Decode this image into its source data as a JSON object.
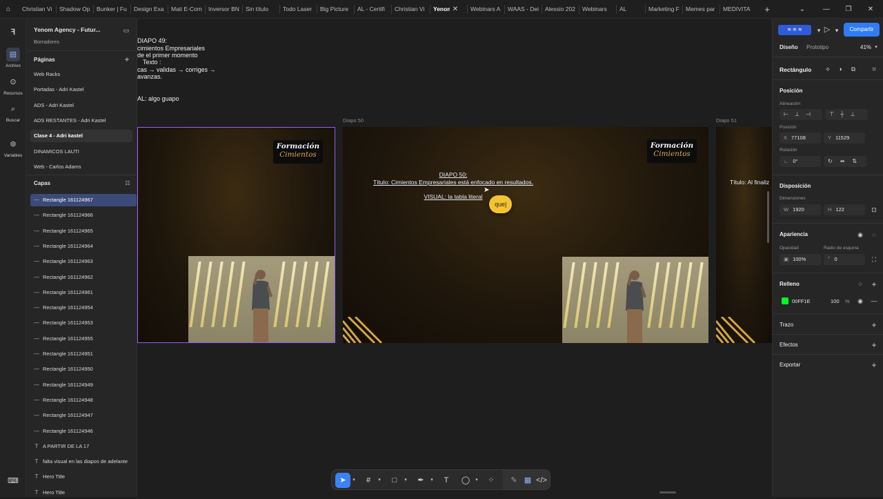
{
  "browser": {
    "tabs": [
      "Christian Vi",
      "Shadow Op",
      "Bunker | Fu",
      "Design Exa",
      "Mati E-Com",
      "Inversor BN",
      "Sin título",
      "Todo Laser",
      "Big Picture",
      "AL - Certifi",
      "Christian Vi",
      "Yenom",
      "Webinars A",
      "WAAS - Dei",
      "Alessio 202",
      "Webinars",
      "AL",
      "Marketing F",
      "Memes par",
      "MEDIVITA"
    ],
    "active_tab_index": 11
  },
  "rail": {
    "items": [
      {
        "label": "Archivo",
        "icon": "file-icon"
      },
      {
        "label": "Recursos",
        "icon": "assets-icon"
      },
      {
        "label": "Buscar",
        "icon": "search-icon"
      },
      {
        "label": "Variables",
        "icon": "variables-icon"
      }
    ]
  },
  "file": {
    "name": "Yenom Agency - Futur...",
    "subtitle": "Borradores"
  },
  "pages": {
    "title": "Páginas",
    "items": [
      "Web Racks",
      "Portadas - Adri Kastel",
      "ADS - Adri Kastel",
      "ADS RESTANTES - Adri Kastel",
      "Clase 4 - Adri kastel",
      "DINAMICOS LAUTI",
      "Web - Carlos Adams"
    ],
    "selected_index": 4
  },
  "layers": {
    "title": "Capas",
    "items": [
      {
        "name": "Rectangle 161124967",
        "type": "rect"
      },
      {
        "name": "Rectangle 161124966",
        "type": "rect"
      },
      {
        "name": "Rectangle 161124965",
        "type": "rect"
      },
      {
        "name": "Rectangle 161124964",
        "type": "rect"
      },
      {
        "name": "Rectangle 161124963",
        "type": "rect"
      },
      {
        "name": "Rectangle 161124962",
        "type": "rect"
      },
      {
        "name": "Rectangle 161124961",
        "type": "rect"
      },
      {
        "name": "Rectangle 161124954",
        "type": "rect"
      },
      {
        "name": "Rectangle 161124953",
        "type": "rect"
      },
      {
        "name": "Rectangle 161124955",
        "type": "rect"
      },
      {
        "name": "Rectangle 161124951",
        "type": "rect"
      },
      {
        "name": "Rectangle 161124950",
        "type": "rect"
      },
      {
        "name": "Rectangle 161124949",
        "type": "rect"
      },
      {
        "name": "Rectangle 161124948",
        "type": "rect"
      },
      {
        "name": "Rectangle 161124947",
        "type": "rect"
      },
      {
        "name": "Rectangle 161124946",
        "type": "rect"
      },
      {
        "name": "A PARTIR DE LA 17",
        "type": "text"
      },
      {
        "name": "falta visual en las diapos de adelante",
        "type": "text"
      },
      {
        "name": "Hero Title",
        "type": "text"
      },
      {
        "name": "Hero Title",
        "type": "text"
      }
    ],
    "selected_index": 0
  },
  "canvas": {
    "notes": [
      "DIAPO 49:",
      "cimientos Empresariales",
      "de el primer momento",
      "Texto :",
      "cas → validas → corriges →",
      "avanzas.",
      "AL: algo guapo"
    ],
    "frame_labels": [
      "Diapo 50",
      "Diapo 51"
    ],
    "logo_line1": "Formación",
    "logo_line2": "Cimientos",
    "slide50_lines": [
      "DIAPO 50:",
      "Título: Cimientos Empresariales está enfocado en resultados.",
      "VISUAL: la tabla literal"
    ],
    "slide51_text": "Título: Al finaliz",
    "comment_text": "que|"
  },
  "right": {
    "tabs": [
      "Diseño",
      "Prototipo"
    ],
    "zoom": "41%",
    "share_label": "Compartir",
    "layer_type": "Rectángulo",
    "position_title": "Posición",
    "alignment_label": "Alineación",
    "position_label": "Posición",
    "x_key": "X",
    "x_value": "77108",
    "y_key": "Y",
    "y_value": "11529",
    "rotation_label": "Rotación",
    "rotation_value": "0°",
    "layout_title": "Disposición",
    "dimensions_label": "Dimensiones",
    "w_key": "W",
    "w_value": "1920",
    "h_key": "H",
    "h_value": "122",
    "appearance_title": "Apariencia",
    "opacity_label": "Opacidad",
    "opacity_value": "100%",
    "radius_label": "Radio de esquina",
    "radius_value": "0",
    "fill_title": "Relleno",
    "fill_hex": "00FF1E",
    "fill_opacity": "100",
    "fill_pct": "%",
    "fill_color": "#00ff1e",
    "stroke_title": "Trazo",
    "effects_title": "Efectos",
    "export_title": "Exportar"
  },
  "colors": {
    "accent": "#2f7cf6",
    "selection": "#9b5cff",
    "comment": "#f4c430"
  }
}
